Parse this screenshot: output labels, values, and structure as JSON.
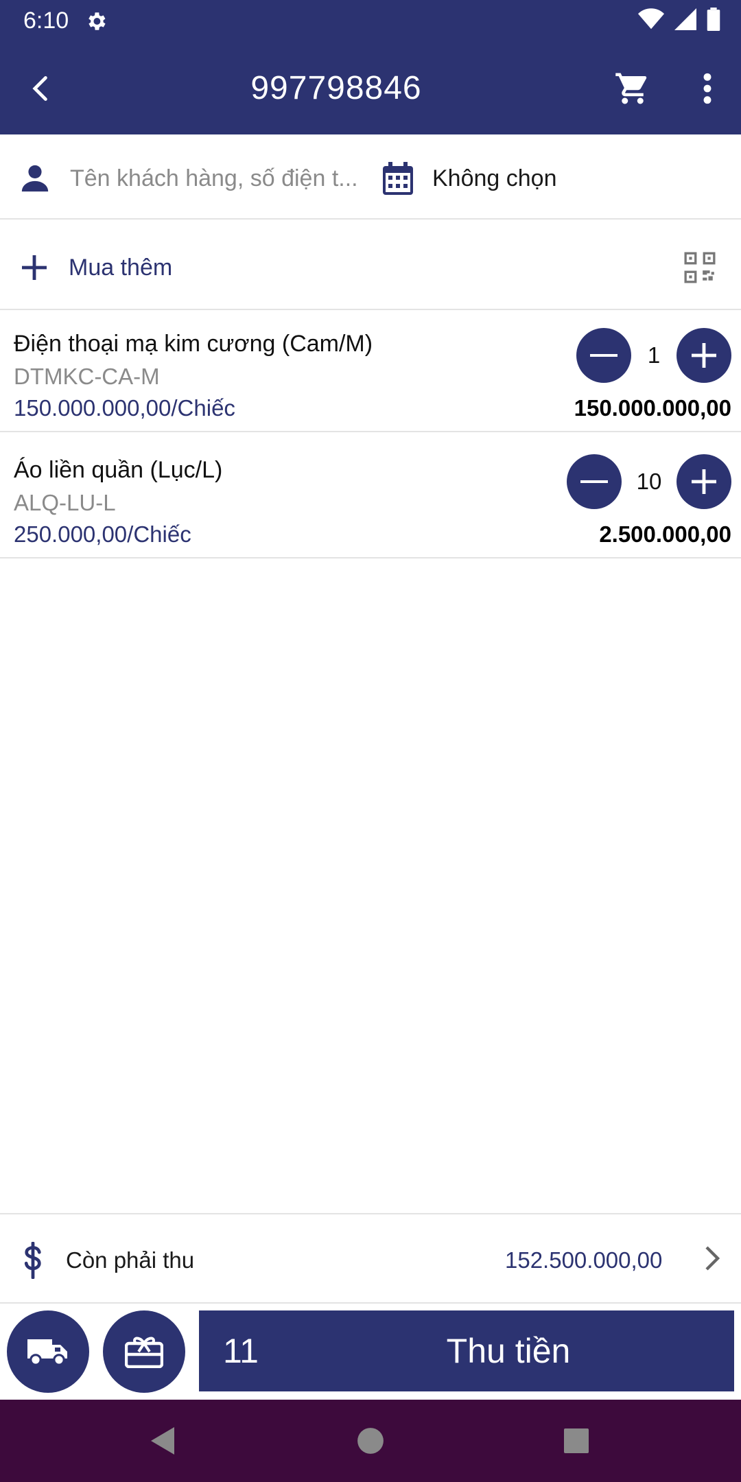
{
  "status_bar": {
    "time": "6:10"
  },
  "app_bar": {
    "title": "997798846"
  },
  "filters": {
    "customer_placeholder": "Tên khách hàng, số điện t...",
    "date_value": "Không chọn"
  },
  "add_more": {
    "label": "Mua thêm"
  },
  "items": [
    {
      "name": "Điện thoại mạ kim cương (Cam/M)",
      "sku": "DTMKC-CA-M",
      "unit_price": "150.000.000,00/Chiếc",
      "quantity": "1",
      "total": "150.000.000,00"
    },
    {
      "name": "Áo liền quần (Lục/L)",
      "sku": "ALQ-LU-L",
      "unit_price": "250.000,00/Chiếc",
      "quantity": "10",
      "total": "2.500.000,00"
    }
  ],
  "remaining": {
    "label": "Còn phải thu",
    "amount": "152.500.000,00"
  },
  "bottom": {
    "item_count": "11",
    "pay_label": "Thu tiền"
  },
  "colors": {
    "primary": "#2c3371",
    "nav_bar": "#3d0a3c"
  }
}
